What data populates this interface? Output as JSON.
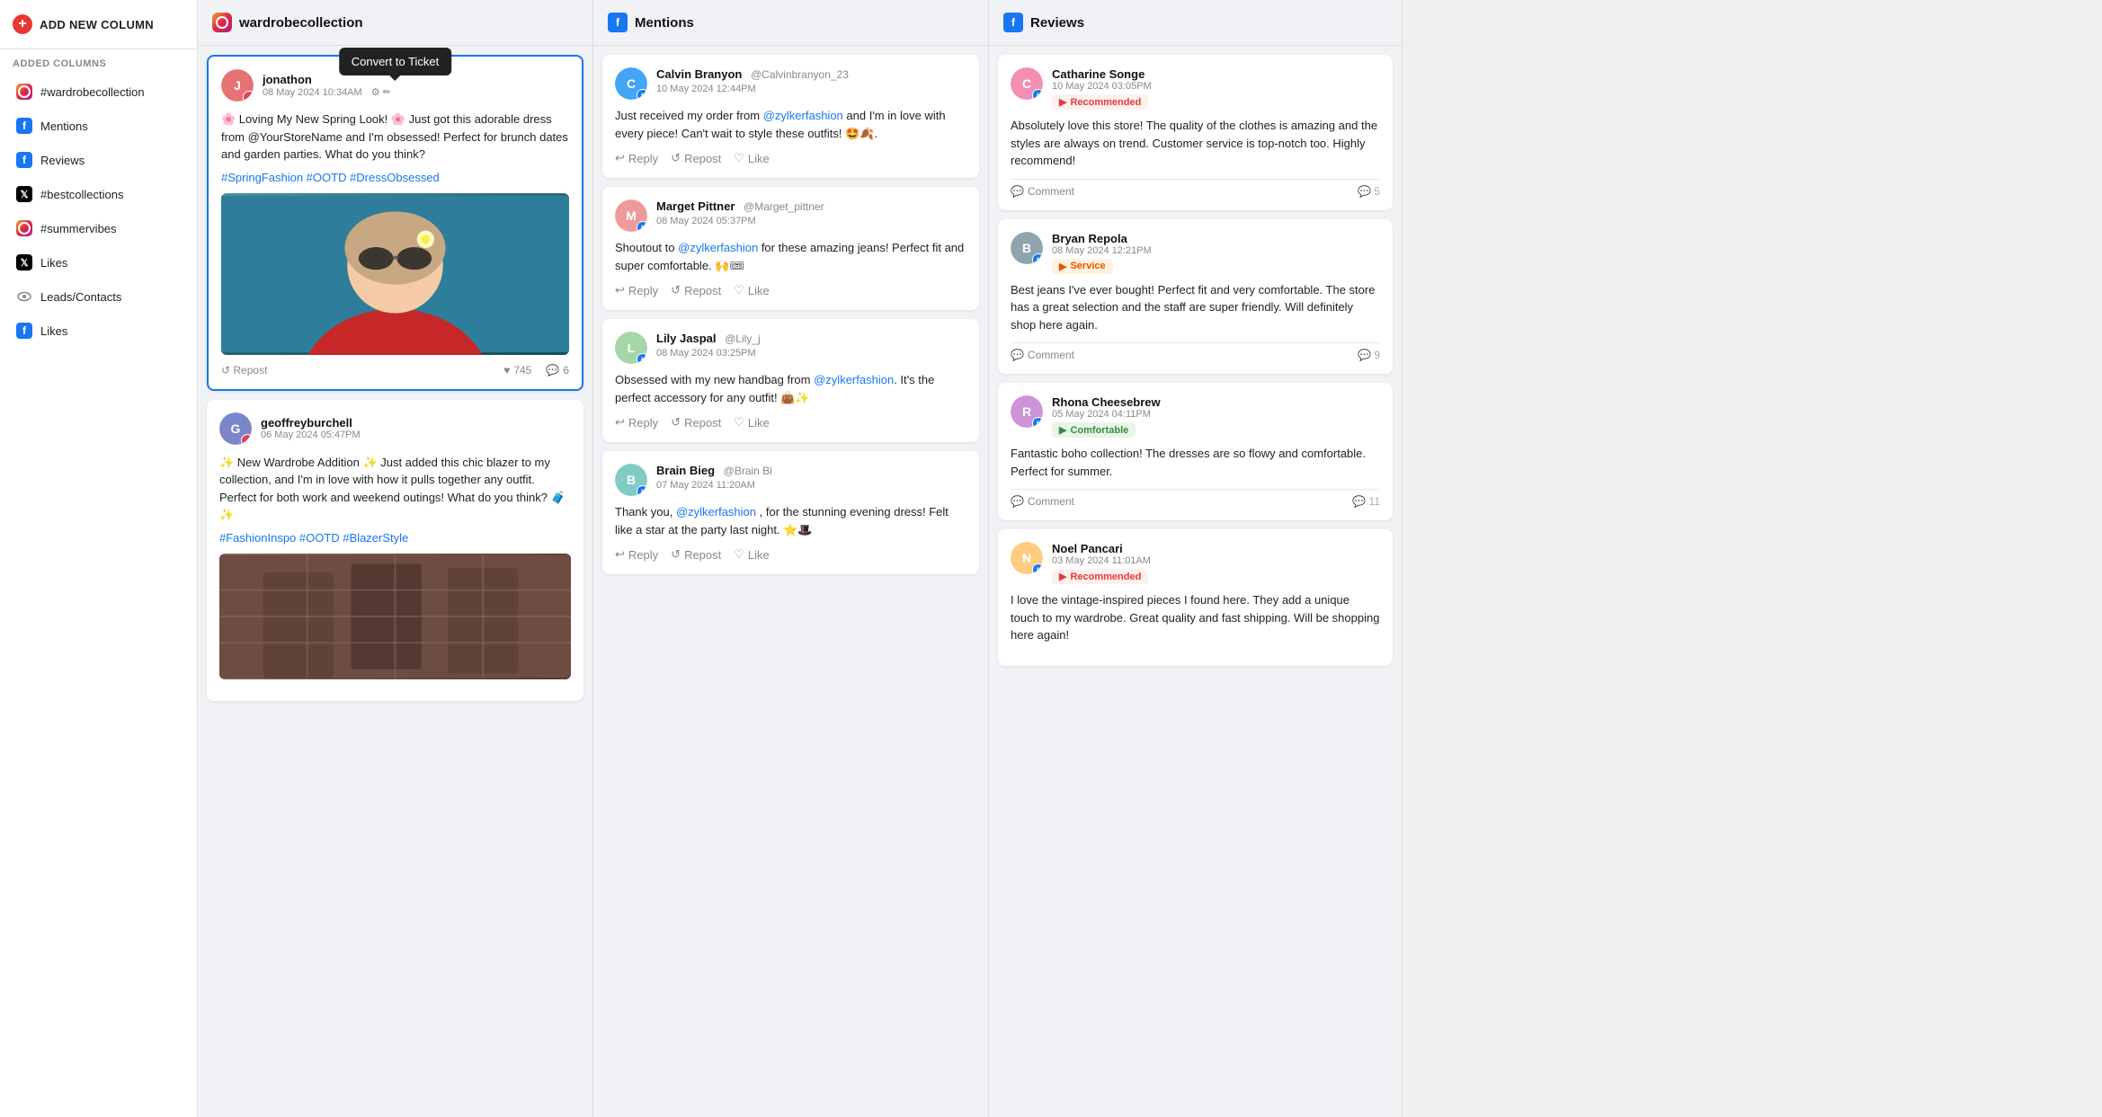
{
  "sidebar": {
    "add_button_label": "ADD NEW COLUMN",
    "added_columns_label": "ADDED COLUMNS",
    "items": [
      {
        "id": "wardrobecollection",
        "label": "#wardrobecollection",
        "icon": "instagram"
      },
      {
        "id": "mentions",
        "label": "Mentions",
        "icon": "facebook"
      },
      {
        "id": "reviews",
        "label": "Reviews",
        "icon": "facebook"
      },
      {
        "id": "bestcollections",
        "label": "#bestcollections",
        "icon": "twitter"
      },
      {
        "id": "summervibes",
        "label": "#summervibes",
        "icon": "instagram"
      },
      {
        "id": "likes",
        "label": "Likes",
        "icon": "twitter"
      },
      {
        "id": "leads",
        "label": "Leads/Contacts",
        "icon": "eye"
      },
      {
        "id": "fb-likes",
        "label": "Likes",
        "icon": "facebook"
      }
    ]
  },
  "columns": {
    "wardrobe": {
      "title": "wardrobecollection",
      "icon": "instagram",
      "posts": [
        {
          "id": "p1",
          "username": "jonathon",
          "datetime": "08 May 2024 10:34AM",
          "avatar_color": "#e57373",
          "avatar_letter": "J",
          "platform": "instagram",
          "content": "🌸 Loving My New Spring Look! 🌸 Just got this adorable dress from @YourStoreName and I'm obsessed! Perfect for brunch dates and garden parties. What do you think?",
          "tags": "#SpringFashion #OOTD #DressObsessed",
          "has_image": true,
          "image_desc": "Woman with sunflower sunglasses red top",
          "likes": 745,
          "comments": 6,
          "show_tooltip": true,
          "tooltip_text": "Convert to Ticket"
        },
        {
          "id": "p2",
          "username": "geoffreyburchell",
          "datetime": "06 May 2024 05:47PM",
          "avatar_color": "#7986cb",
          "avatar_letter": "G",
          "platform": "instagram",
          "content": "✨ New Wardrobe Addition ✨ Just added this chic blazer to my collection, and I'm in love with how it pulls together any outfit. Perfect for both work and weekend outings! What do you think? 🧳 ✨",
          "tags": "#FashionInspo #OOTD #BlazerStyle",
          "has_image": true,
          "image_desc": "Plaid blazer on hanger",
          "likes": null,
          "comments": null,
          "show_tooltip": false,
          "tooltip_text": ""
        }
      ]
    },
    "mentions": {
      "title": "Mentions",
      "icon": "facebook",
      "items": [
        {
          "id": "m1",
          "name": "Calvin Branyon",
          "handle": "@Calvinbranyon_23",
          "datetime": "10 May 2024 12:44PM",
          "avatar_color": "#42a5f5",
          "avatar_letter": "C",
          "platform": "facebook",
          "content": "Just received my order from @zylkerfashion and I'm in love with every piece! Can't wait to style these outfits! 🤩🍂.",
          "mention_link": "@zylkerfashion"
        },
        {
          "id": "m2",
          "name": "Marget Pittner",
          "handle": "@Marget_pittner",
          "datetime": "08 May 2024 05:37PM",
          "avatar_color": "#ef9a9a",
          "avatar_letter": "M",
          "platform": "facebook",
          "content": "Shoutout to @zylkerfashion for these amazing jeans! Perfect fit and super comfortable. 🙌🎟",
          "mention_link": "@zylkerfashion"
        },
        {
          "id": "m3",
          "name": "Lily Jaspal",
          "handle": "@Lily_j",
          "datetime": "08 May 2024 03:25PM",
          "avatar_color": "#a5d6a7",
          "avatar_letter": "L",
          "platform": "facebook",
          "content": "Obsessed with my new handbag from @zylkerfashion. It's the perfect accessory for any outfit! 👜✨",
          "mention_link": "@zylkerfashion"
        },
        {
          "id": "m4",
          "name": "Brain Bieg",
          "handle": "@Brain Bi",
          "datetime": "07 May 2024 11:20AM",
          "avatar_color": "#80cbc4",
          "avatar_letter": "B",
          "platform": "facebook",
          "content": "Thank you, @zylkerfashion , for the stunning evening dress! Felt like a star at the party last night. ⭐🎩",
          "mention_link": "@zylkerfashion"
        }
      ],
      "actions": {
        "reply": "Reply",
        "repost": "Repost",
        "like": "Like"
      }
    },
    "reviews": {
      "title": "Reviews",
      "icon": "facebook",
      "items": [
        {
          "id": "r1",
          "name": "Catharine Songe",
          "datetime": "10 May 2024 03:05PM",
          "avatar_color": "#f48fb1",
          "avatar_letter": "C",
          "platform": "facebook",
          "badge": "Recommended",
          "badge_type": "recommended",
          "content": "Absolutely love this store! The quality of the clothes is amazing and the styles are always on trend. Customer service is top-notch too. Highly recommend!",
          "comment_count": 5
        },
        {
          "id": "r2",
          "name": "Bryan Repola",
          "datetime": "08 May 2024 12:21PM",
          "avatar_color": "#90a4ae",
          "avatar_letter": "B",
          "platform": "facebook",
          "badge": "Service",
          "badge_type": "service",
          "content": "Best jeans I've ever bought! Perfect fit and very comfortable. The store has a great selection and the staff are super friendly. Will definitely shop here again.",
          "comment_count": 9
        },
        {
          "id": "r3",
          "name": "Rhona Cheesebrew",
          "datetime": "05 May 2024 04:11PM",
          "avatar_color": "#ce93d8",
          "avatar_letter": "R",
          "platform": "facebook",
          "badge": "Comfortable",
          "badge_type": "comfortable",
          "content": "Fantastic boho collection! The dresses are so flowy and comfortable. Perfect for summer.",
          "comment_count": 11
        },
        {
          "id": "r4",
          "name": "Noel Pancari",
          "datetime": "03 May 2024 11:01AM",
          "avatar_color": "#ffcc80",
          "avatar_letter": "N",
          "platform": "facebook",
          "badge": "Recommended",
          "badge_type": "recommended",
          "content": "I love the vintage-inspired pieces I found here. They add a unique touch to my wardrobe. Great quality and fast shipping. Will be shopping here again!",
          "comment_count": null
        }
      ],
      "comment_label": "Comment"
    }
  },
  "icons": {
    "reply_icon": "↩",
    "repost_icon": "↺",
    "like_icon": "♡",
    "heart_icon": "♥",
    "comment_icon": "💬",
    "repost_prefix": "↺"
  }
}
